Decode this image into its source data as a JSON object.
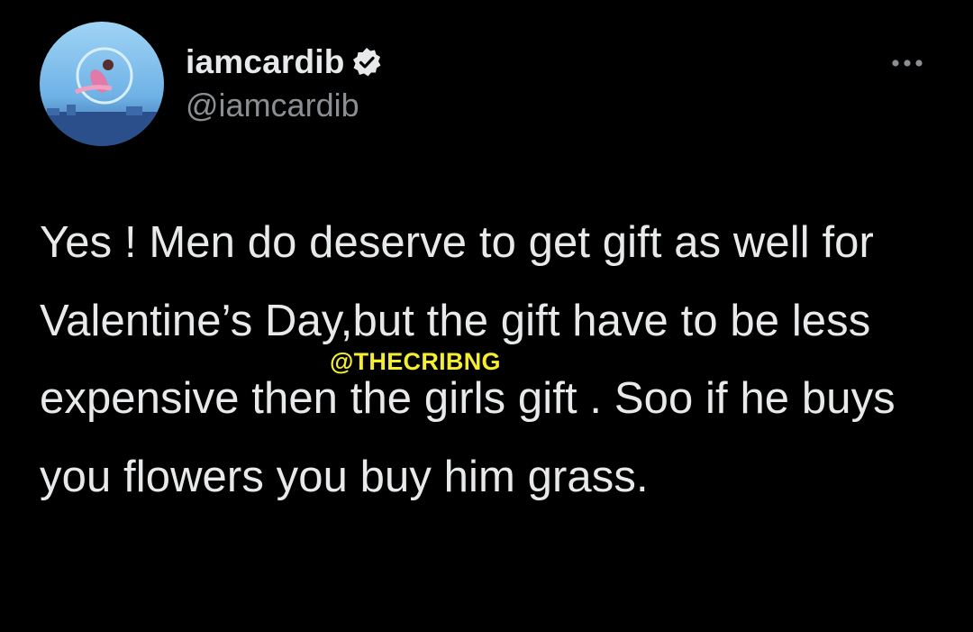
{
  "tweet": {
    "display_name": "iamcardib",
    "handle": "@iamcardib",
    "verified": true,
    "more_icon": "more-horizontal-icon",
    "text": "Yes ! Men do deserve to get gift as well for Valentine’s Day,but the gift have to be less expensive then the girls gift . Soo if he buys you flowers you buy him grass."
  },
  "watermark": {
    "text": "@THECRIBNG"
  },
  "colors": {
    "background": "#000000",
    "primary_text": "#e7e9ea",
    "secondary_text": "#8b8f94",
    "watermark": "#f4ee2f"
  }
}
